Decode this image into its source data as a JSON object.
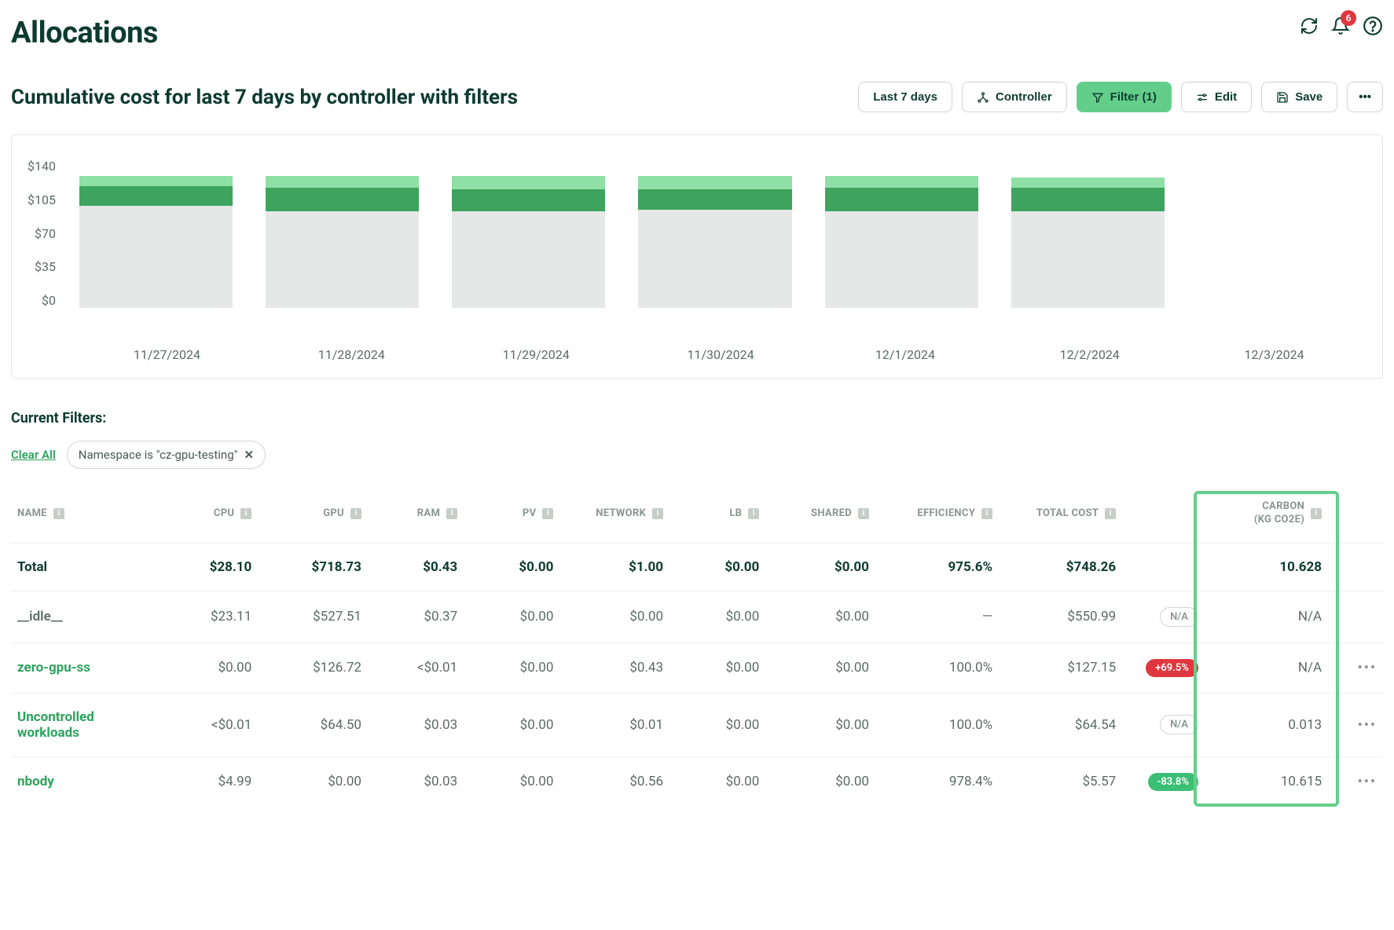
{
  "header": {
    "title": "Allocations",
    "notif_count": "6"
  },
  "subtitle": "Cumulative cost for last 7 days by controller with filters",
  "toolbar": {
    "range": "Last 7 days",
    "controller": "Controller",
    "filter": "Filter (1)",
    "edit": "Edit",
    "save": "Save"
  },
  "filters": {
    "label": "Current Filters:",
    "clear": "Clear All",
    "chip": "Namespace is \"cz-gpu-testing\""
  },
  "chart_data": {
    "type": "bar",
    "title": "",
    "xlabel": "",
    "ylabel": "",
    "ylim": [
      0,
      140
    ],
    "y_ticks": [
      "$140",
      "$105",
      "$70",
      "$35",
      "$0"
    ],
    "categories": [
      "11/27/2024",
      "11/28/2024",
      "11/29/2024",
      "11/30/2024",
      "12/1/2024",
      "12/2/2024",
      "12/3/2024"
    ],
    "series": [
      {
        "name": "grey",
        "values": [
          96,
          91,
          91,
          92,
          91,
          91,
          0
        ]
      },
      {
        "name": "mid",
        "values": [
          18,
          22,
          20,
          19,
          22,
          22,
          0
        ]
      },
      {
        "name": "light",
        "values": [
          10,
          11,
          13,
          13,
          11,
          9,
          0
        ]
      }
    ]
  },
  "table": {
    "headers": {
      "name": "NAME",
      "cpu": "CPU",
      "gpu": "GPU",
      "ram": "RAM",
      "pv": "PV",
      "network": "NETWORK",
      "lb": "LB",
      "shared": "SHARED",
      "efficiency": "EFFICIENCY",
      "total_cost": "TOTAL COST",
      "carbon_l1": "CARBON",
      "carbon_l2": "(KG CO2E)"
    },
    "rows": [
      {
        "kind": "total",
        "name": "Total",
        "cpu": "$28.10",
        "gpu": "$718.73",
        "ram": "$0.43",
        "pv": "$0.00",
        "network": "$1.00",
        "lb": "$0.00",
        "shared": "$0.00",
        "efficiency": "975.6%",
        "total": "$748.26",
        "badge": "",
        "badge_style": "",
        "carbon": "10.628",
        "more": false
      },
      {
        "kind": "idle",
        "name": "__idle__",
        "cpu": "$23.11",
        "gpu": "$527.51",
        "ram": "$0.37",
        "pv": "$0.00",
        "network": "$0.00",
        "lb": "$0.00",
        "shared": "$0.00",
        "efficiency": "—",
        "total": "$550.99",
        "badge": "N/A",
        "badge_style": "na",
        "carbon": "N/A",
        "more": false
      },
      {
        "kind": "link",
        "name": "zero-gpu-ss",
        "cpu": "$0.00",
        "gpu": "$126.72",
        "ram": "<$0.01",
        "pv": "$0.00",
        "network": "$0.43",
        "lb": "$0.00",
        "shared": "$0.00",
        "efficiency": "100.0%",
        "total": "$127.15",
        "badge": "+69.5%",
        "badge_style": "red",
        "carbon": "N/A",
        "more": true
      },
      {
        "kind": "link",
        "name": "Uncontrolled workloads",
        "cpu": "<$0.01",
        "gpu": "$64.50",
        "ram": "$0.03",
        "pv": "$0.00",
        "network": "$0.01",
        "lb": "$0.00",
        "shared": "$0.00",
        "efficiency": "100.0%",
        "total": "$64.54",
        "badge": "N/A",
        "badge_style": "na",
        "carbon": "0.013",
        "more": true
      },
      {
        "kind": "link",
        "name": "nbody",
        "cpu": "$4.99",
        "gpu": "$0.00",
        "ram": "$0.03",
        "pv": "$0.00",
        "network": "$0.56",
        "lb": "$0.00",
        "shared": "$0.00",
        "efficiency": "978.4%",
        "total": "$5.57",
        "badge": "-83.8%",
        "badge_style": "green",
        "carbon": "10.615",
        "more": true
      }
    ]
  }
}
